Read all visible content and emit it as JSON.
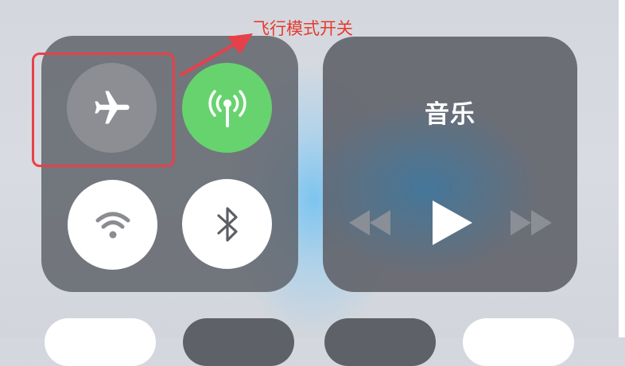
{
  "annotation": {
    "label": "飞行模式开关",
    "color": "#e63a2e"
  },
  "control_center": {
    "connectivity": {
      "airplane_mode": {
        "icon": "airplane-icon",
        "state": "off"
      },
      "cellular_data": {
        "icon": "antenna-icon",
        "state": "on",
        "color": "#67d36e"
      },
      "wifi": {
        "icon": "wifi-icon",
        "state": "on"
      },
      "bluetooth": {
        "icon": "bluetooth-icon",
        "state": "on"
      }
    },
    "music": {
      "title": "音乐",
      "controls": {
        "rewind_icon": "rewind-icon",
        "play_icon": "play-icon",
        "fast_forward_icon": "fast-forward-icon"
      }
    }
  }
}
